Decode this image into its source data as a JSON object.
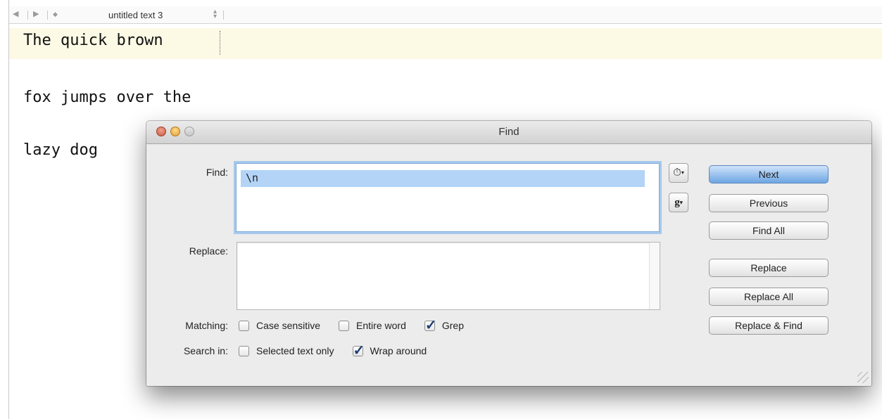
{
  "editor": {
    "nav": {
      "back_glyph": "◀",
      "forward_glyph": "▶",
      "marker_glyph": "◆",
      "stepper_up": "▴",
      "stepper_down": "▾"
    },
    "document_title": "untitled text 3",
    "lines": [
      "The quick brown",
      "fox jumps over the",
      "lazy dog"
    ]
  },
  "find_dialog": {
    "title": "Find",
    "find_label": "Find:",
    "find_value": "\\n",
    "replace_label": "Replace:",
    "replace_value": "",
    "history_icon_glyph": "⏱",
    "grep_pattern_glyph": "g",
    "popup_arrow": "▾",
    "matching": {
      "label": "Matching:",
      "options": [
        {
          "label": "Case sensitive",
          "checked": false
        },
        {
          "label": "Entire word",
          "checked": false
        },
        {
          "label": "Grep",
          "checked": true
        }
      ]
    },
    "search_in": {
      "label": "Search in:",
      "options": [
        {
          "label": "Selected text only",
          "checked": false
        },
        {
          "label": "Wrap around",
          "checked": true
        }
      ]
    },
    "buttons": {
      "next": "Next",
      "previous": "Previous",
      "find_all": "Find All",
      "replace": "Replace",
      "replace_all": "Replace All",
      "replace_find": "Replace & Find"
    }
  },
  "colors": {
    "current_line_highlight": "#fcf9e5",
    "default_button": "#6ea6e3",
    "find_selection": "#b3d4f7",
    "close_light": "#c65a44",
    "minimize_light": "#e2a030"
  }
}
